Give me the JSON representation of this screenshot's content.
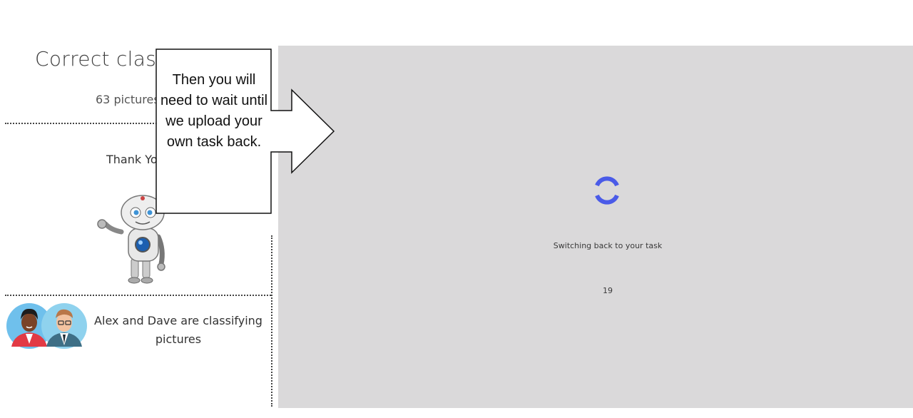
{
  "sidebar": {
    "title": "Correct classif",
    "subtitle": "63 pictures",
    "thanks": "Thank Yo",
    "status": "Alex and Dave are classifying pictures"
  },
  "callout": {
    "text": "Then you will need to wait until we upload your own task back."
  },
  "main": {
    "switching_text": "Switching back to your task",
    "countdown": "19",
    "spinner_color": "#4a5be8",
    "background": "#dad9da"
  }
}
